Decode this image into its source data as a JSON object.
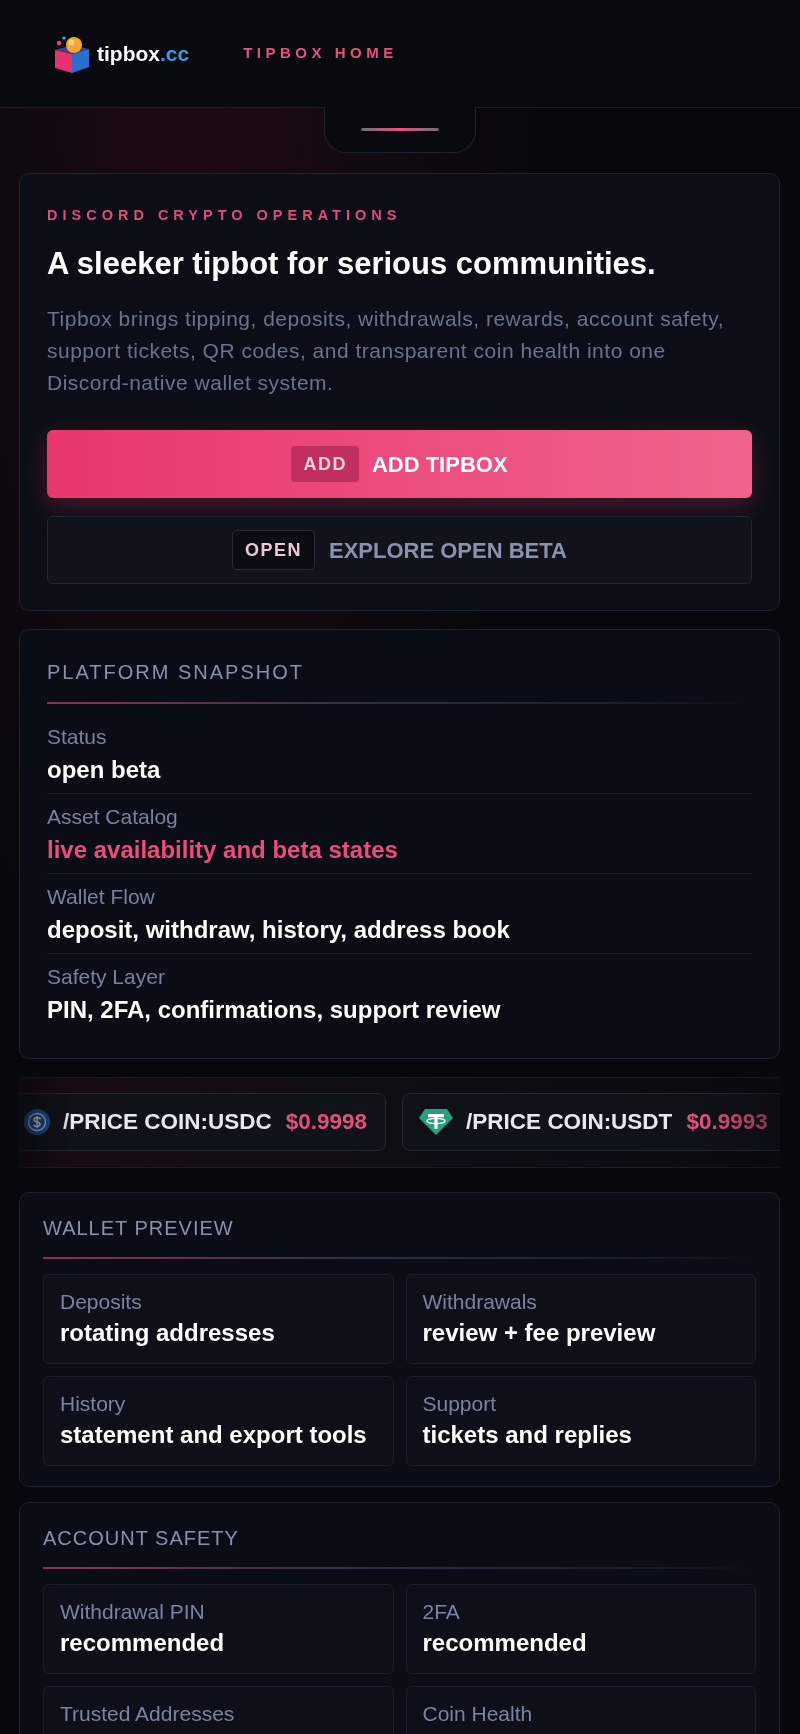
{
  "header": {
    "logo": {
      "wordmark": "tipbox",
      "suffix": ".cc"
    },
    "nav_link": "TIPBOX HOME"
  },
  "hero": {
    "eyebrow": "DISCORD CRYPTO OPERATIONS",
    "title": "A sleeker tipbot for serious communities.",
    "description": "Tipbox brings tipping, deposits, withdrawals, rewards, account safety, support tickets, QR codes, and transparent coin health into one Discord-native wallet system.",
    "actions": [
      {
        "kind": "primary",
        "badge": "ADD",
        "label": "ADD TIPBOX"
      },
      {
        "kind": "secondary",
        "badge": "OPEN",
        "label": "EXPLORE OPEN BETA"
      }
    ]
  },
  "snapshot": {
    "title": "PLATFORM SNAPSHOT",
    "rows": [
      {
        "label": "Status",
        "value": "open beta",
        "highlighted": false
      },
      {
        "label": "Asset Catalog",
        "value": "live availability and beta states",
        "highlighted": true
      },
      {
        "label": "Wallet Flow",
        "value": "deposit, withdraw, history, address book",
        "highlighted": false
      },
      {
        "label": "Safety Layer",
        "value": "PIN, 2FA, confirmations, support review",
        "highlighted": false
      }
    ]
  },
  "ticker": [
    {
      "kind": "usdc",
      "command": "/PRICE COIN:USDC",
      "price": "$0.9998"
    },
    {
      "kind": "usdt",
      "command": "/PRICE COIN:USDT",
      "price": "$0.9993"
    }
  ],
  "panels": [
    {
      "title": "WALLET PREVIEW",
      "tiles": [
        {
          "label": "Deposits",
          "value": "rotating addresses"
        },
        {
          "label": "Withdrawals",
          "value": "review + fee preview"
        },
        {
          "label": "History",
          "value": "statement and export tools"
        },
        {
          "label": "Support",
          "value": "tickets and replies"
        }
      ]
    },
    {
      "title": "ACCOUNT SAFETY",
      "tiles": [
        {
          "label": "Withdrawal PIN",
          "value": "recommended"
        },
        {
          "label": "2FA",
          "value": "recommended"
        },
        {
          "label": "Trusted Addresses"
        },
        {
          "label": "Coin Health"
        }
      ]
    }
  ]
}
